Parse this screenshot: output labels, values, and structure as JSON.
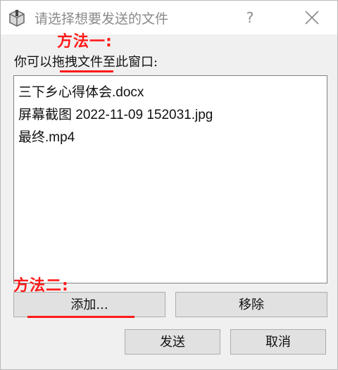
{
  "window": {
    "title": "请选择想要发送的文件",
    "help_label": "?"
  },
  "annotations": {
    "method1": "方法一:",
    "method2": "方法二:"
  },
  "instruction": "你可以拖拽文件至此窗口:",
  "files": [
    "三下乡心得体会.docx",
    "屏幕截图 2022-11-09 152031.jpg",
    "最终.mp4"
  ],
  "buttons": {
    "add": "添加...",
    "remove": "移除",
    "send": "发送",
    "cancel": "取消"
  },
  "colors": {
    "annotation": "#ff1a1a",
    "dialog_bg": "#f0f0f0",
    "button_bg": "#e1e1e1"
  }
}
